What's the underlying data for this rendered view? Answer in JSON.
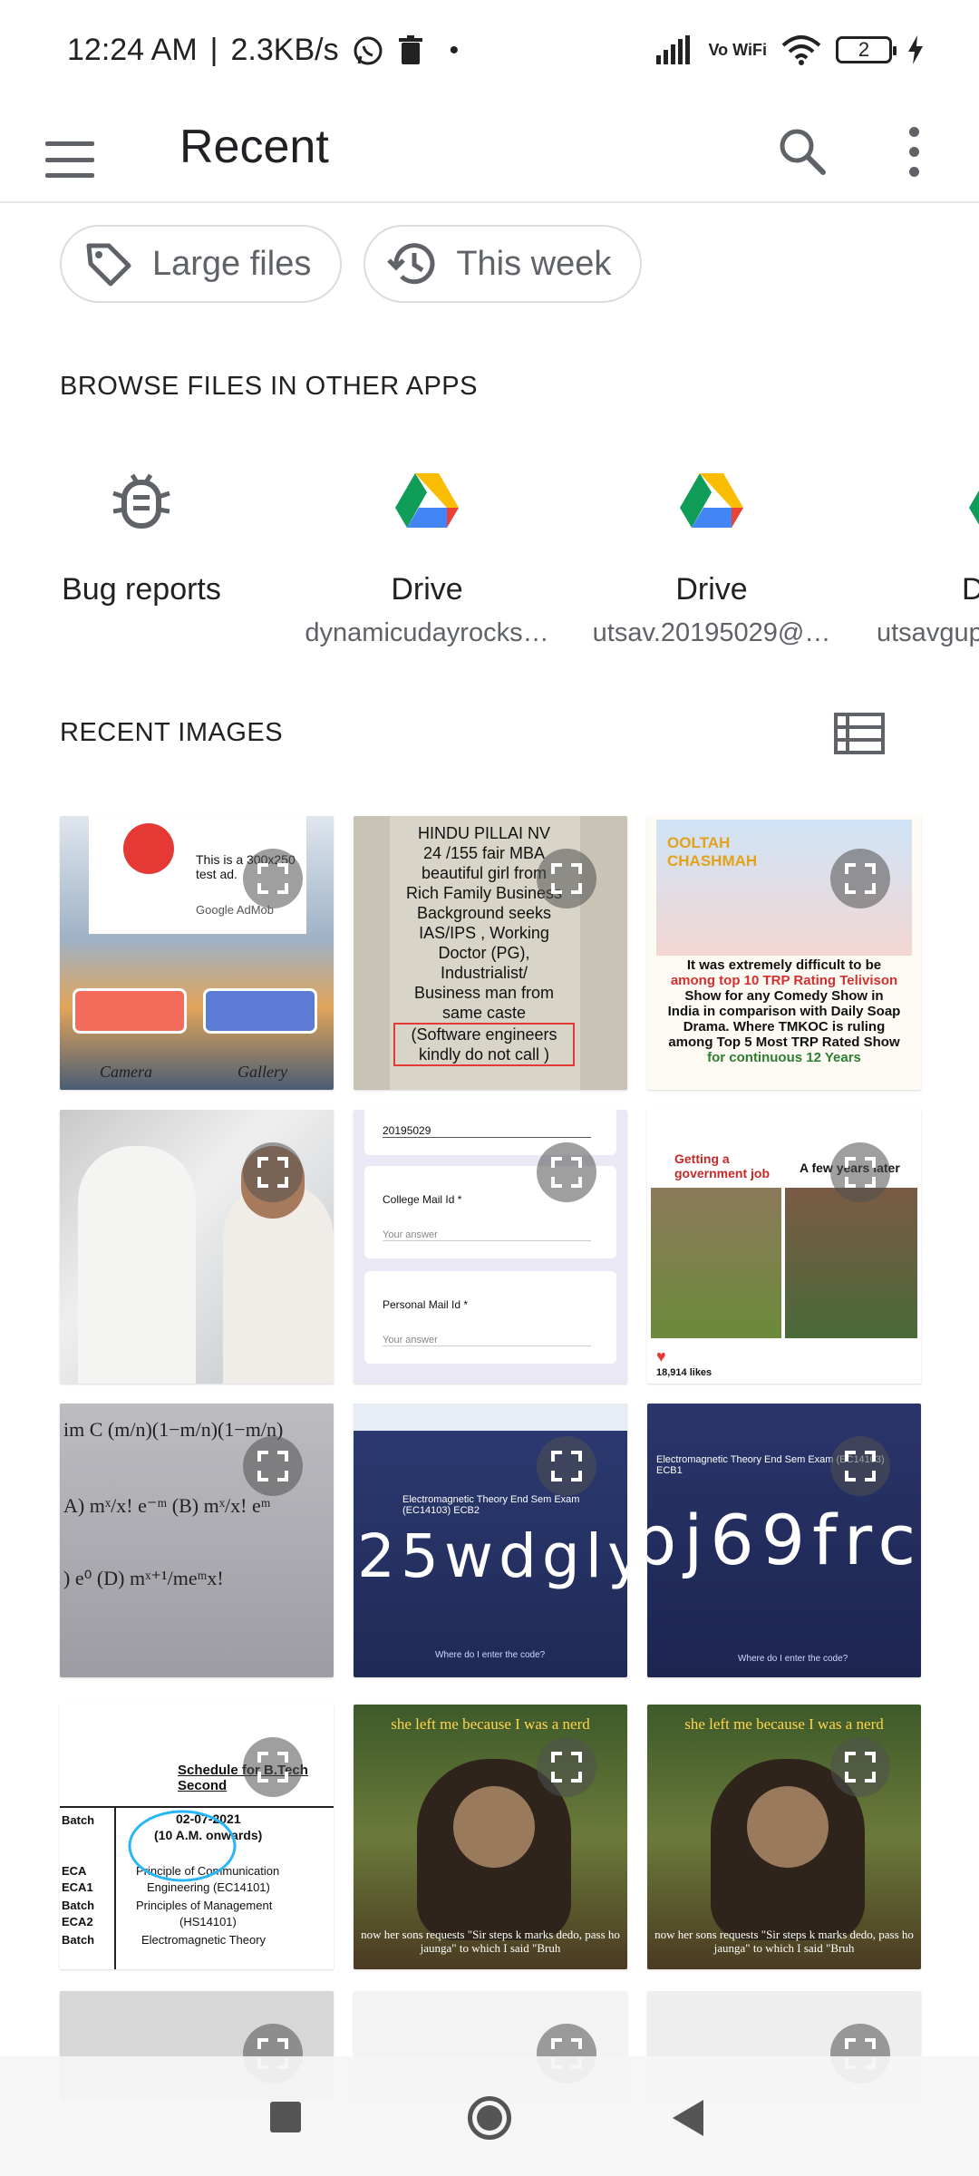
{
  "status_bar": {
    "time": "12:24 AM",
    "net_speed": "2.3KB/s",
    "battery": "2",
    "vowifi": "Vo WiFi",
    "icons": [
      "whatsapp-icon",
      "trash-icon",
      "dot-icon",
      "signal-icon",
      "wifi-icon",
      "battery-icon",
      "charging-icon"
    ]
  },
  "app_bar": {
    "title": "Recent",
    "icons": [
      "menu-icon",
      "search-icon",
      "more-vert-icon"
    ]
  },
  "chips": [
    {
      "label": "Large files",
      "icon": "tag-icon"
    },
    {
      "label": "This week",
      "icon": "history-icon"
    }
  ],
  "browse": {
    "title": "BROWSE FILES IN OTHER APPS",
    "apps": [
      {
        "name": "Bug reports",
        "subtitle": "",
        "icon": "bug-icon"
      },
      {
        "name": "Drive",
        "subtitle": "dynamicudayrocks…",
        "icon": "drive-icon"
      },
      {
        "name": "Drive",
        "subtitle": "utsav.20195029@…",
        "icon": "drive-icon"
      },
      {
        "name": "D",
        "subtitle": "utsavgup",
        "icon": "drive-icon"
      }
    ]
  },
  "recent_images": {
    "title": "RECENT IMAGES",
    "toggle_icon": "list-view-icon",
    "thumb_text": {
      "t1_ad": "This is a 300x250 test ad.",
      "t1_admob": "Google AdMob",
      "t1_camera": "Camera",
      "t1_gallery": "Gallery",
      "t2_lines": [
        "HINDU PILLAI NV",
        "24 /155 fair MBA",
        "beautiful girl from",
        "Rich Family Business",
        "Background seeks",
        "IAS/IPS , Working",
        "Doctor (PG),",
        "Industrialist/",
        "Business man from",
        "same caste",
        "(Software engineers",
        "kindly do not call )"
      ],
      "t3_top": "OOLTAH CHASHMAH",
      "t3_lines": [
        "It was extremely difficult to be",
        "among top 10 TRP Rating Telivison",
        "Show for any Comedy Show in",
        "India in comparison with Daily Soap",
        "Drama. Where TMKOC is ruling",
        "among Top 5 Most TRP Rated Show",
        "for continuous 12 Years"
      ],
      "t5_value": "20195029",
      "t5_q1": "College Mail Id *",
      "t5_q2": "Personal Mail Id *",
      "t5_answer": "Your answer",
      "t6_left": "Getting a government job",
      "t6_right": "A few years later",
      "t6_likes": "18,914 likes",
      "t8_title": "Electromagnetic Theory End Sem Exam (EC14103) ECB2",
      "t8_code": "25wdgly",
      "t8_prompt": "Where do I enter the code?",
      "t9_title": "Electromagnetic Theory End Sem Exam (EC14103) ECB1",
      "t9_code": "pj69frc",
      "t9_prompt": "Where do I enter the code?",
      "t10_heading": "Schedule for B.Tech Second",
      "t10_date": "02-07-2021",
      "t10_time": "(10 A.M. onwards)",
      "t10_rows": [
        [
          "Batch",
          ""
        ],
        [
          "ECA",
          "Principle of Communication"
        ],
        [
          "ECA1",
          "Engineering (EC14101)"
        ],
        [
          "Batch",
          "Principles of Management"
        ],
        [
          "ECA2",
          "(HS14101)"
        ],
        [
          "Batch",
          "Electromagnetic Theory"
        ]
      ],
      "t11_top": "she left me because I was a nerd",
      "t11_bottom": "now her sons requests \"Sir steps k marks dedo, pass ho jaunga\" to which I said \"Bruh",
      "t12_top": "she left me because I was a nerd",
      "t12_bottom": "now her sons requests \"Sir steps k marks dedo, pass ho jaunga\" to which I said \"Bruh"
    }
  },
  "nav_bar": {
    "icons": [
      "recents-square-icon",
      "home-circle-icon",
      "back-triangle-icon"
    ]
  }
}
